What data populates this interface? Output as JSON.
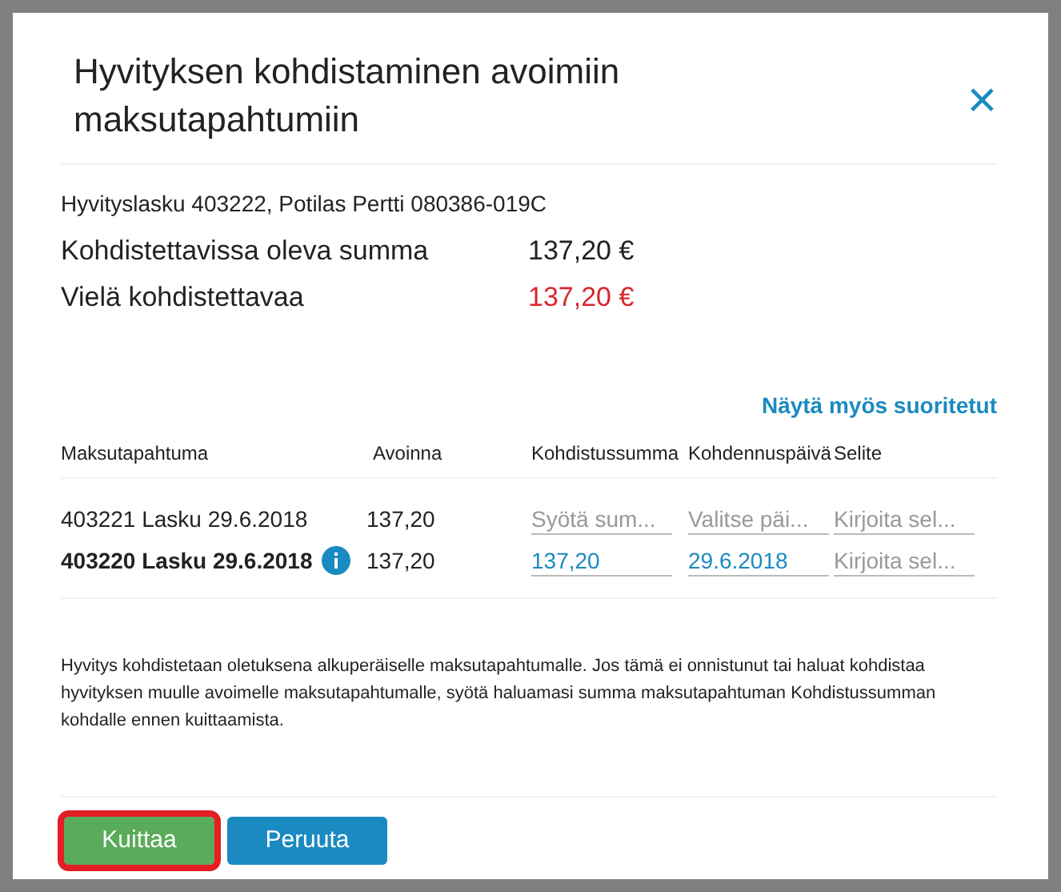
{
  "dialog": {
    "title": "Hyvityksen kohdistaminen avoimiin maksutapahtumiin",
    "close": "×"
  },
  "invoice_line": "Hyvityslasku 403222, Potilas Pertti 080386-019C",
  "summary": [
    {
      "label": "Kohdistettavissa oleva summa",
      "value": "137,20 €",
      "warning": false
    },
    {
      "label": "Vielä kohdistettavaa",
      "value": "137,20 €",
      "warning": true
    }
  ],
  "show_completed_link": "Näytä myös suoritetut",
  "table": {
    "columns": [
      "Maksutapahtuma",
      "Avoinna",
      "Kohdistussumma",
      "Kohdennuspäivä",
      "Selite"
    ],
    "rows": [
      {
        "transaction": "403221 Lasku 29.6.2018",
        "original": false,
        "open": "137,20",
        "amount": {
          "placeholder": "Syötä sum..."
        },
        "date": {
          "placeholder": "Valitse päi..."
        },
        "note": {
          "placeholder": "Kirjoita sel..."
        }
      },
      {
        "transaction": "403220 Lasku 29.6.2018",
        "original": true,
        "open": "137,20",
        "amount": {
          "value": "137,20"
        },
        "date": {
          "value": "29.6.2018"
        },
        "note": {
          "placeholder": "Kirjoita sel..."
        }
      }
    ]
  },
  "help_text": "Hyvitys kohdistetaan oletuksena alkuperäiselle maksutapahtumalle. Jos tämä ei onnistunut tai haluat kohdistaa hyvityksen muulle avoimelle maksutapahtumalle, syötä haluamasi summa maksutapahtuman Kohdistussumman kohdalle ennen kuittaamista.",
  "buttons": [
    {
      "label": "Kuittaa",
      "kind": "confirm",
      "focused": true
    },
    {
      "label": "Peruuta",
      "kind": "cancel",
      "focused": false
    }
  ]
}
